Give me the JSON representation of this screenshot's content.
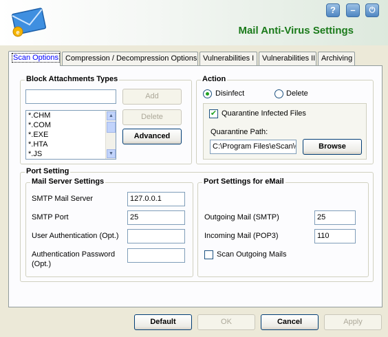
{
  "window": {
    "title": "Mail Anti-Virus Settings",
    "help_label": "?",
    "minimize_label": "–",
    "power_label": "⏻"
  },
  "tabs": [
    {
      "label": "Scan Options",
      "active": true
    },
    {
      "label": "Compression / Decompression Options",
      "active": false
    },
    {
      "label": "Vulnerabilities I",
      "active": false
    },
    {
      "label": "Vulnerabilities II",
      "active": false
    },
    {
      "label": "Archiving",
      "active": false
    }
  ],
  "block_attachments": {
    "title": "Block Attachments Types",
    "input_value": "",
    "add_label": "Add",
    "delete_label": "Delete",
    "advanced_label": "Advanced",
    "items": [
      "*.CHM",
      "*.COM",
      "*.EXE",
      "*.HTA",
      "*.JS"
    ]
  },
  "action": {
    "title": "Action",
    "disinfect_label": "Disinfect",
    "delete_label": "Delete",
    "selected": "disinfect",
    "quarantine_label": "Quarantine Infected Files",
    "quarantine_checked": true,
    "quarantine_path_label": "Quarantine Path:",
    "quarantine_path_value": "C:\\Program Files\\eScan\\Q",
    "browse_label": "Browse"
  },
  "port_setting": {
    "title": "Port Setting",
    "mail_server": {
      "title": "Mail Server Settings",
      "smtp_server_label": "SMTP Mail Server",
      "smtp_server_value": "127.0.0.1",
      "smtp_port_label": "SMTP Port",
      "smtp_port_value": "25",
      "user_auth_label": "User Authentication (Opt.)",
      "user_auth_value": "",
      "auth_password_label_1": "Authentication Password",
      "auth_password_label_2": "(Opt.)",
      "auth_password_value": ""
    },
    "email_ports": {
      "title": "Port Settings for eMail",
      "outgoing_label": "Outgoing Mail (SMTP)",
      "outgoing_value": "25",
      "incoming_label": "Incoming Mail (POP3)",
      "incoming_value": "110",
      "scan_outgoing_label": "Scan Outgoing Mails",
      "scan_outgoing_checked": false
    }
  },
  "footer": {
    "default_label": "Default",
    "ok_label": "OK",
    "cancel_label": "Cancel",
    "apply_label": "Apply"
  },
  "colors": {
    "title_green": "#1a7a1a",
    "dialog_bg": "#ece9d8",
    "panel_bg": "#fcfcfe"
  },
  "icons": {
    "logo": "envelope-icon",
    "help": "help-icon",
    "minimize": "minimize-icon",
    "power": "power-icon"
  }
}
